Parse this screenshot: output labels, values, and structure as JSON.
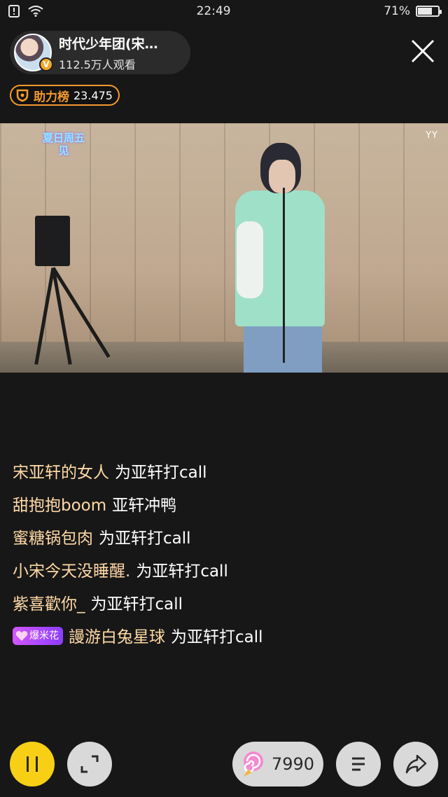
{
  "status_bar": {
    "time": "22:49",
    "battery_percent": "71%",
    "battery_level": 0.71
  },
  "streamer": {
    "name": "时代少年团(宋…",
    "viewers": "112.5万人观看",
    "verified_badge": "V"
  },
  "rank": {
    "label": "助力榜",
    "value": "23.475"
  },
  "video": {
    "logo_text": "夏日周五见",
    "watermark": "YY"
  },
  "chat": [
    {
      "user": "宋亚轩的女人",
      "message": "为亚轩打call"
    },
    {
      "user": "甜抱抱boom",
      "message": "亚轩冲鸭"
    },
    {
      "user": "蜜糖锅包肉",
      "message": "为亚轩打call"
    },
    {
      "user": "小宋今天没睡醒.",
      "message": "为亚轩打call"
    },
    {
      "user": "紫喜歡你_",
      "message": "为亚轩打call"
    },
    {
      "badge": "爆米花",
      "user": "謾游白兔星球",
      "message": "为亚轩打call"
    }
  ],
  "bottom_bar": {
    "gift_count": "7990",
    "icons": [
      "pause-icon",
      "fullscreen-icon",
      "lollipop-icon",
      "menu-icon",
      "share-icon"
    ]
  },
  "colors": {
    "background": "#171717",
    "accent_yellow": "#f7cf14",
    "rank_orange": "#f39a2c",
    "username": "#ffd9a6"
  }
}
